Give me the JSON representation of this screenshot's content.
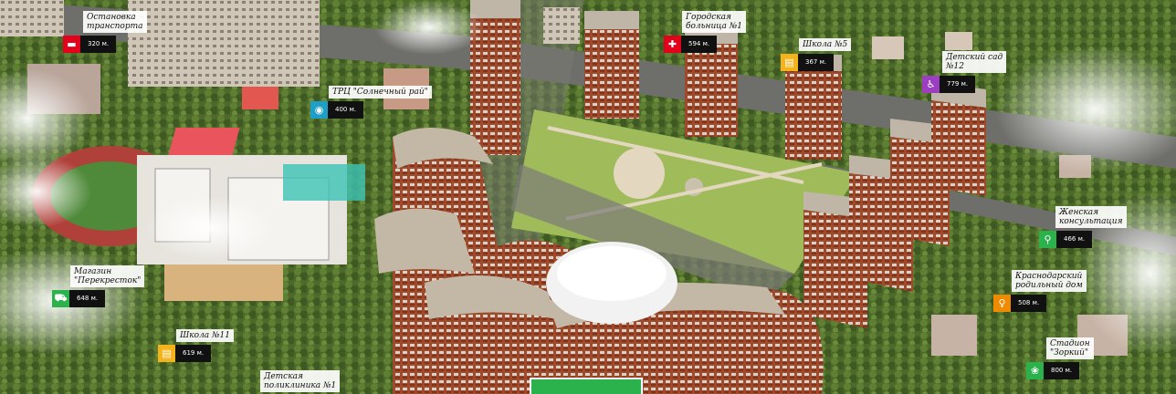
{
  "pois": [
    {
      "id": "bus",
      "label": "Остановка\nтранспорта",
      "distance": "320 м.",
      "icon": "bus-icon",
      "color": "#e2001a",
      "glyph": "▬"
    },
    {
      "id": "hospital",
      "label": "Городская\nбольница №1",
      "distance": "594 м.",
      "icon": "medical-cross-icon",
      "color": "#e2001a",
      "glyph": "✚"
    },
    {
      "id": "school5",
      "label": "Школа №5",
      "distance": "367 м.",
      "icon": "school-icon",
      "color": "#f4b31a",
      "glyph": "▤"
    },
    {
      "id": "kindergarten",
      "label": "Детский сад\n№12",
      "distance": "779 м.",
      "icon": "stroller-icon",
      "color": "#9b3fc0",
      "glyph": "♿"
    },
    {
      "id": "mall",
      "label": "ТРЦ \"Солнечный рай\"",
      "distance": "400 м.",
      "icon": "shopping-center-icon",
      "color": "#1e9fc7",
      "glyph": "◉"
    },
    {
      "id": "womens",
      "label": "Женская\nконсультация",
      "distance": "466 м.",
      "icon": "magnifier-icon",
      "color": "#2bb24c",
      "glyph": "⚲"
    },
    {
      "id": "store",
      "label": "Магазин\n\"Перекресток\"",
      "distance": "648 м.",
      "icon": "cart-icon",
      "color": "#2bb24c",
      "glyph": "🛒"
    },
    {
      "id": "maternity",
      "label": "Краснодарский\nродильный дом",
      "distance": "508 м.",
      "icon": "baby-icon",
      "color": "#f08a00",
      "glyph": "♀"
    },
    {
      "id": "school11",
      "label": "Школа №11",
      "distance": "619 м.",
      "icon": "school-icon",
      "color": "#f4b31a",
      "glyph": "▤"
    },
    {
      "id": "stadium",
      "label": "Стадион\n\"Зоркий\"",
      "distance": "800 м.",
      "icon": "stadium-icon",
      "color": "#2bb24c",
      "glyph": "❀"
    },
    {
      "id": "clinic",
      "label": "Детская\nполиклиника №1",
      "distance": "",
      "icon": "",
      "color": "",
      "glyph": ""
    }
  ],
  "cta": {
    "label": ""
  }
}
